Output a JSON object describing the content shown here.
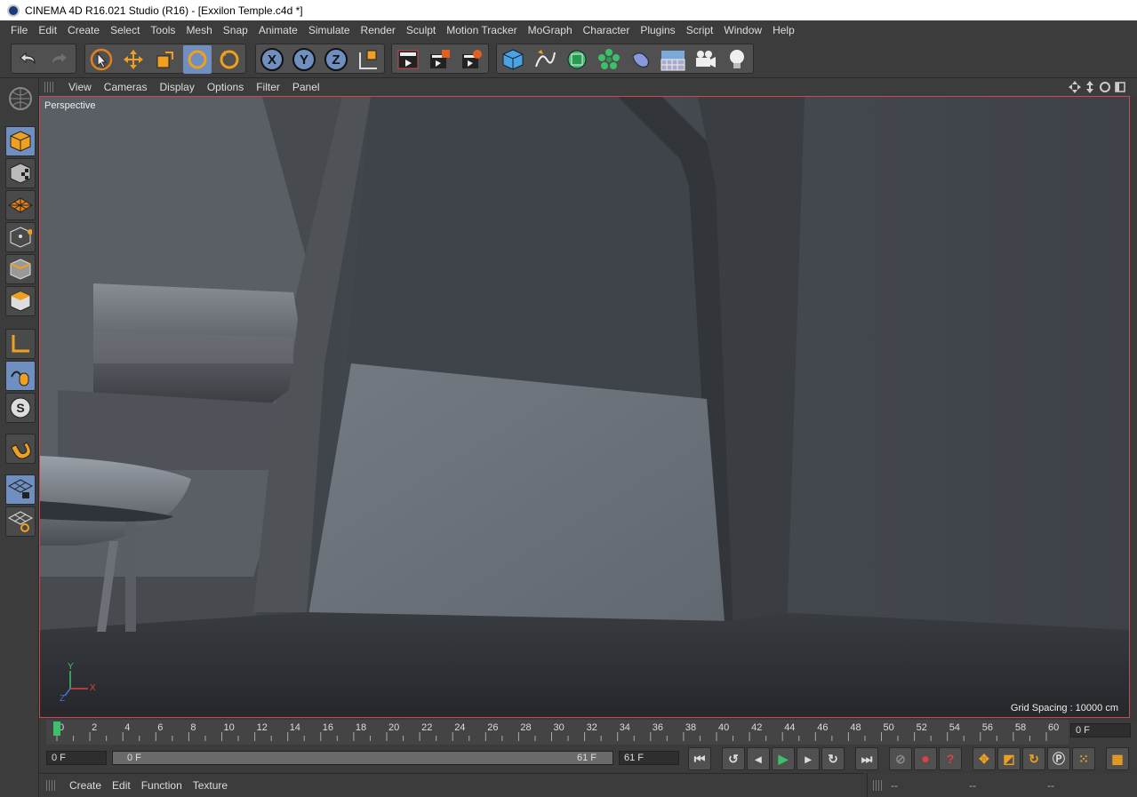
{
  "window": {
    "title": "CINEMA 4D R16.021 Studio (R16) - [Exxilon Temple.c4d *]"
  },
  "menubar": {
    "items": [
      "File",
      "Edit",
      "Create",
      "Select",
      "Tools",
      "Mesh",
      "Snap",
      "Animate",
      "Simulate",
      "Render",
      "Sculpt",
      "Motion Tracker",
      "MoGraph",
      "Character",
      "Plugins",
      "Script",
      "Window",
      "Help"
    ]
  },
  "toolbar": {
    "x_label": "X",
    "y_label": "Y",
    "z_label": "Z",
    "icons": [
      "undo-icon",
      "redo-icon",
      "live-selection-icon",
      "move-icon",
      "scale-icon",
      "rotate-icon",
      "recent-tool-icon",
      "x-axis-icon",
      "y-axis-icon",
      "z-axis-icon",
      "coordinate-system-icon",
      "render-view-icon",
      "render-picture-viewer-icon",
      "render-settings-icon",
      "cube-icon",
      "pen-spline-icon",
      "subdivision-icon",
      "cloner-icon",
      "deformer-icon",
      "floor-icon",
      "camera-icon",
      "light-icon"
    ]
  },
  "left_toolbar": {
    "s_label": "S",
    "icons": [
      "make-editable-icon",
      "model-mode-icon",
      "texture-mode-icon",
      "workplane-mode-icon",
      "points-mode-icon",
      "edges-mode-icon",
      "polygons-mode-icon",
      "enable-axis-icon",
      "tweak-mode-icon",
      "solo-icon",
      "snap-magnet-icon",
      "locked-workplane-icon",
      "planar-workplane-icon"
    ]
  },
  "viewport_menu": {
    "items": [
      "View",
      "Cameras",
      "Display",
      "Options",
      "Filter",
      "Panel"
    ]
  },
  "viewport": {
    "label": "Perspective",
    "grid_spacing": "Grid Spacing : 10000 cm",
    "axis_x": "X",
    "axis_y": "Y",
    "axis_z": "Z",
    "border_color": "#c84a4a"
  },
  "timeline": {
    "ticks": [
      "0",
      "2",
      "4",
      "6",
      "8",
      "10",
      "12",
      "14",
      "16",
      "18",
      "20",
      "22",
      "24",
      "26",
      "28",
      "30",
      "32",
      "34",
      "36",
      "38",
      "40",
      "42",
      "44",
      "46",
      "48",
      "50",
      "52",
      "54",
      "56",
      "58",
      "60"
    ],
    "current_frame": "0 F",
    "max_frame": 60
  },
  "transport": {
    "start_field": "0 F",
    "range_start": "0 F",
    "range_end": "61 F",
    "end_field": "61 F"
  },
  "material_manager": {
    "items": [
      "Create",
      "Edit",
      "Function",
      "Texture"
    ]
  },
  "attribute_manager": {
    "fields": [
      "--",
      "--",
      "--"
    ]
  }
}
